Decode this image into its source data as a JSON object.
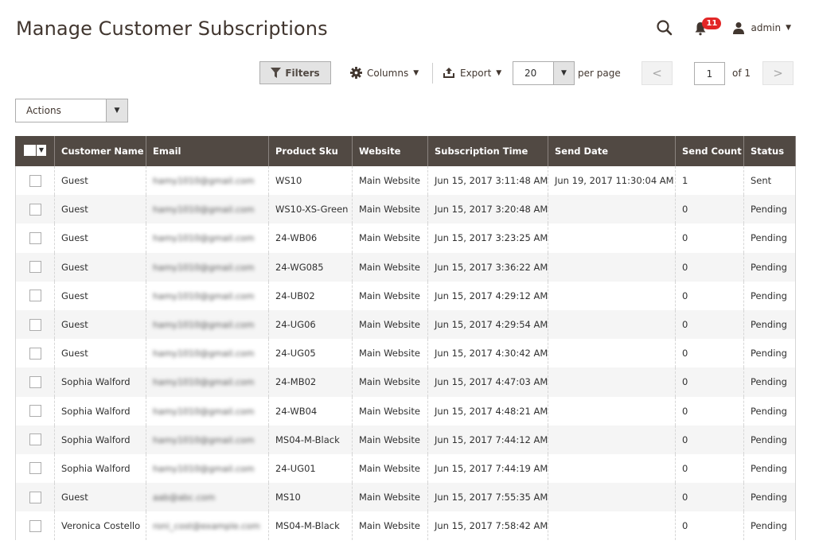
{
  "page": {
    "title": "Manage Customer Subscriptions"
  },
  "header": {
    "search_icon": "search-icon",
    "notifications": {
      "icon": "bell-icon",
      "count": "11"
    },
    "user": {
      "icon": "user-icon",
      "name": "admin"
    }
  },
  "toolbar": {
    "filters_label": "Filters",
    "columns_label": "Columns",
    "export_label": "Export",
    "per_page_value": "20",
    "per_page_label": "per page",
    "current_page": "1",
    "page_of_label": "of 1",
    "prev_icon": "chevron-left-icon",
    "next_icon": "chevron-right-icon"
  },
  "actions": {
    "label": "Actions"
  },
  "colors": {
    "header_bg": "#514943",
    "badge": "#e22626",
    "filter_btn_bg": "#e3e3e3",
    "row_alt_bg": "#f5f5f5"
  },
  "grid": {
    "columns": [
      "Customer Name",
      "Email",
      "Product Sku",
      "Website",
      "Subscription Time",
      "Send Date",
      "Send Count",
      "Status"
    ],
    "rows": [
      {
        "name": "Guest",
        "email": "hamy1010@gmail.com",
        "sku": "WS10",
        "website": "Main Website",
        "sub_time": "Jun 15, 2017 3:11:48 AM",
        "send_date": "Jun 19, 2017 11:30:04 AM",
        "send_count": "1",
        "status": "Sent"
      },
      {
        "name": "Guest",
        "email": "hamy1010@gmail.com",
        "sku": "WS10-XS-Green",
        "website": "Main Website",
        "sub_time": "Jun 15, 2017 3:20:48 AM",
        "send_date": "",
        "send_count": "0",
        "status": "Pending"
      },
      {
        "name": "Guest",
        "email": "hamy1010@gmail.com",
        "sku": "24-WB06",
        "website": "Main Website",
        "sub_time": "Jun 15, 2017 3:23:25 AM",
        "send_date": "",
        "send_count": "0",
        "status": "Pending"
      },
      {
        "name": "Guest",
        "email": "hamy1010@gmail.com",
        "sku": "24-WG085",
        "website": "Main Website",
        "sub_time": "Jun 15, 2017 3:36:22 AM",
        "send_date": "",
        "send_count": "0",
        "status": "Pending"
      },
      {
        "name": "Guest",
        "email": "hamy1010@gmail.com",
        "sku": "24-UB02",
        "website": "Main Website",
        "sub_time": "Jun 15, 2017 4:29:12 AM",
        "send_date": "",
        "send_count": "0",
        "status": "Pending"
      },
      {
        "name": "Guest",
        "email": "hamy1010@gmail.com",
        "sku": "24-UG06",
        "website": "Main Website",
        "sub_time": "Jun 15, 2017 4:29:54 AM",
        "send_date": "",
        "send_count": "0",
        "status": "Pending"
      },
      {
        "name": "Guest",
        "email": "hamy1010@gmail.com",
        "sku": "24-UG05",
        "website": "Main Website",
        "sub_time": "Jun 15, 2017 4:30:42 AM",
        "send_date": "",
        "send_count": "0",
        "status": "Pending"
      },
      {
        "name": "Sophia Walford",
        "email": "hamy1010@gmail.com",
        "sku": "24-MB02",
        "website": "Main Website",
        "sub_time": "Jun 15, 2017 4:47:03 AM",
        "send_date": "",
        "send_count": "0",
        "status": "Pending"
      },
      {
        "name": "Sophia Walford",
        "email": "hamy1010@gmail.com",
        "sku": "24-WB04",
        "website": "Main Website",
        "sub_time": "Jun 15, 2017 4:48:21 AM",
        "send_date": "",
        "send_count": "0",
        "status": "Pending"
      },
      {
        "name": "Sophia Walford",
        "email": "hamy1010@gmail.com",
        "sku": "MS04-M-Black",
        "website": "Main Website",
        "sub_time": "Jun 15, 2017 7:44:12 AM",
        "send_date": "",
        "send_count": "0",
        "status": "Pending"
      },
      {
        "name": "Sophia Walford",
        "email": "hamy1010@gmail.com",
        "sku": "24-UG01",
        "website": "Main Website",
        "sub_time": "Jun 15, 2017 7:44:19 AM",
        "send_date": "",
        "send_count": "0",
        "status": "Pending"
      },
      {
        "name": "Guest",
        "email": "aab@abc.com",
        "sku": "MS10",
        "website": "Main Website",
        "sub_time": "Jun 15, 2017 7:55:35 AM",
        "send_date": "",
        "send_count": "0",
        "status": "Pending"
      },
      {
        "name": "Veronica Costello",
        "email": "roni_cost@example.com",
        "sku": "MS04-M-Black",
        "website": "Main Website",
        "sub_time": "Jun 15, 2017 7:58:42 AM",
        "send_date": "",
        "send_count": "0",
        "status": "Pending"
      }
    ]
  }
}
